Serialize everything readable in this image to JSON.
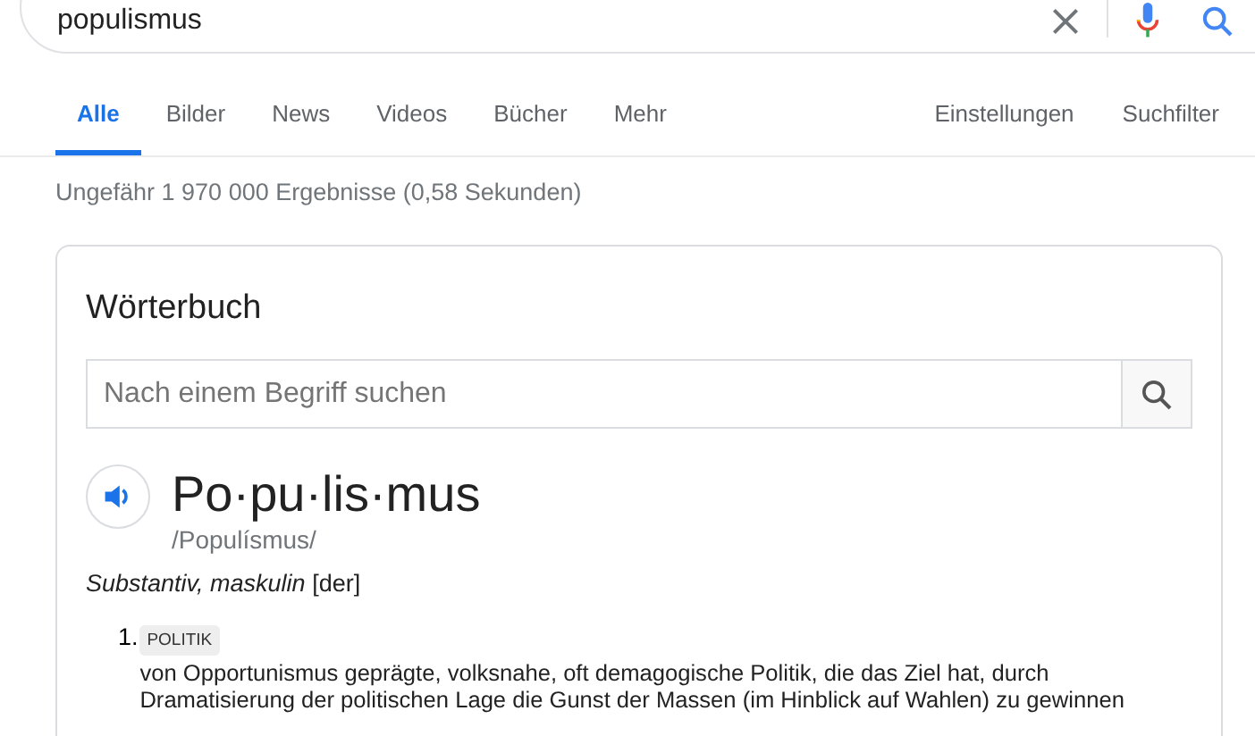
{
  "search": {
    "value": "populismus"
  },
  "tabs": [
    {
      "label": "Alle",
      "selected": true
    },
    {
      "label": "Bilder",
      "selected": false
    },
    {
      "label": "News",
      "selected": false
    },
    {
      "label": "Videos",
      "selected": false
    },
    {
      "label": "Bücher",
      "selected": false
    },
    {
      "label": "Mehr",
      "selected": false
    }
  ],
  "tools": [
    "Einstellungen",
    "Suchfilter"
  ],
  "result_stats": "Ungefähr 1 970 000 Ergebnisse (0,58 Sekunden)",
  "dictionary": {
    "title": "Wörterbuch",
    "search_placeholder": "Nach einem Begriff suchen",
    "headword": "Po·pu·lis·mus",
    "pronunciation": "/Populísmus/",
    "grammar": "*Substantiv, maskulin* [der]",
    "senses": [
      {
        "number": "1.",
        "tag": "POLITIK",
        "definition": "von Opportunismus geprägte, volksnahe, oft demagogische Politik, die das Ziel hat, durch Dramatisierung der politischen Lage die Gunst der Massen (im Hinblick auf Wahlen) zu gewinnen"
      }
    ]
  }
}
